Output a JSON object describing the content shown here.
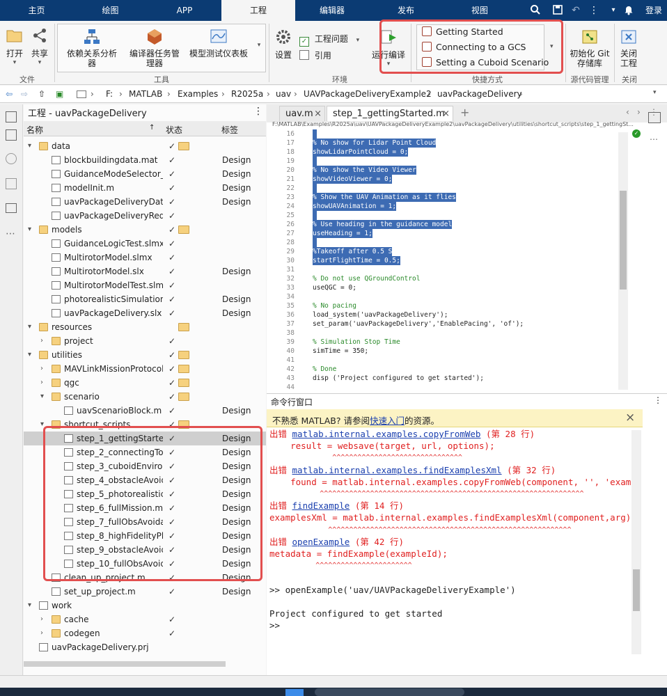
{
  "tabs": [
    "主页",
    "绘图",
    "APP",
    "工程",
    "编辑器",
    "发布",
    "视图"
  ],
  "login_label": "登录",
  "ribbon": {
    "file": {
      "open": "打开",
      "share": "共享",
      "section": "文件"
    },
    "tools": {
      "dep": "依赖关系分析器",
      "compiler": "编译器任务管理器",
      "dashboard": "模型测试仪表板",
      "section": "工具"
    },
    "env": {
      "settings": "设置",
      "issues": "工程问题",
      "references": "引用",
      "run_compile": "运行编译",
      "section": "环境"
    },
    "shortcuts": {
      "items": [
        "Getting Started",
        "Connecting to a GCS",
        "Setting a Cuboid Scenario"
      ],
      "section": "快捷方式"
    },
    "git": {
      "init": "初始化 Git 存储库",
      "section": "源代码管理"
    },
    "close": {
      "label": "关闭工程",
      "section": "关闭"
    }
  },
  "address": [
    "F:",
    "MATLAB",
    "Examples",
    "R2025a",
    "uav",
    "UAVPackageDeliveryExample2",
    "uavPackageDelivery"
  ],
  "project": {
    "title": "工程 - uavPackageDelivery",
    "cols": {
      "name": "名称",
      "status": "状态",
      "label": "标签"
    },
    "rows": [
      {
        "name": "data",
        "depth": 1,
        "folder": true,
        "open": true,
        "label": ""
      },
      {
        "name": "blockbuildingdata.mat",
        "depth": 2,
        "folder": false,
        "label": "Design"
      },
      {
        "name": "GuidanceModeSelector_...",
        "depth": 2,
        "folder": false,
        "label": "Design"
      },
      {
        "name": "modelInit.m",
        "depth": 2,
        "folder": false,
        "label": "Design"
      },
      {
        "name": "uavPackageDeliveryData...",
        "depth": 2,
        "folder": false,
        "label": "Design"
      },
      {
        "name": "uavPackageDeliveryReqs...",
        "depth": 2,
        "folder": false,
        "label": ""
      },
      {
        "name": "models",
        "depth": 1,
        "folder": true,
        "open": true,
        "label": ""
      },
      {
        "name": "GuidanceLogicTest.slmx",
        "depth": 2,
        "folder": false,
        "label": ""
      },
      {
        "name": "MultirotorModel.slmx",
        "depth": 2,
        "folder": false,
        "label": ""
      },
      {
        "name": "MultirotorModel.slx",
        "depth": 2,
        "folder": false,
        "label": "Design"
      },
      {
        "name": "MultirotorModelTest.slmx",
        "depth": 2,
        "folder": false,
        "label": ""
      },
      {
        "name": "photorealisticSimulation...",
        "depth": 2,
        "folder": false,
        "label": "Design"
      },
      {
        "name": "uavPackageDelivery.slx",
        "depth": 2,
        "folder": false,
        "label": "Design"
      },
      {
        "name": "resources",
        "depth": 1,
        "folder": true,
        "open": true,
        "label": ""
      },
      {
        "name": "project",
        "depth": 2,
        "folder": true,
        "open": false,
        "label": ""
      },
      {
        "name": "utilities",
        "depth": 1,
        "folder": true,
        "open": true,
        "label": ""
      },
      {
        "name": "MAVLinkMissionProtocol...",
        "depth": 2,
        "folder": true,
        "open": false,
        "label": ""
      },
      {
        "name": "qgc",
        "depth": 2,
        "folder": true,
        "open": false,
        "label": ""
      },
      {
        "name": "scenario",
        "depth": 2,
        "folder": true,
        "open": true,
        "label": ""
      },
      {
        "name": "uavScenarioBlock.m",
        "depth": 3,
        "folder": false,
        "label": "Design"
      },
      {
        "name": "shortcut_scripts",
        "depth": 2,
        "folder": true,
        "open": true,
        "label": ""
      },
      {
        "name": "step_1_gettingStarte...",
        "depth": 3,
        "folder": false,
        "label": "Design",
        "sel": true
      },
      {
        "name": "step_2_connectingTo...",
        "depth": 3,
        "folder": false,
        "label": "Design"
      },
      {
        "name": "step_3_cuboidEnviro...",
        "depth": 3,
        "folder": false,
        "label": "Design"
      },
      {
        "name": "step_4_obstacleAvoid...",
        "depth": 3,
        "folder": false,
        "label": "Design"
      },
      {
        "name": "step_5_photorealistic...",
        "depth": 3,
        "folder": false,
        "label": "Design"
      },
      {
        "name": "step_6_fullMission.m",
        "depth": 3,
        "folder": false,
        "label": "Design"
      },
      {
        "name": "step_7_fullObsAvoida...",
        "depth": 3,
        "folder": false,
        "label": "Design"
      },
      {
        "name": "step_8_highFidelityPl...",
        "depth": 3,
        "folder": false,
        "label": "Design"
      },
      {
        "name": "step_9_obstacleAvoid...",
        "depth": 3,
        "folder": false,
        "label": "Design"
      },
      {
        "name": "step_10_fullObsAvoid...",
        "depth": 3,
        "folder": false,
        "label": "Design"
      },
      {
        "name": "clean_up_project.m",
        "depth": 2,
        "folder": false,
        "label": "Design"
      },
      {
        "name": "set_up_project.m",
        "depth": 2,
        "folder": false,
        "label": "Design"
      },
      {
        "name": "work",
        "depth": 1,
        "folder": false,
        "open": true,
        "label": ""
      },
      {
        "name": "cache",
        "depth": 2,
        "folder": true,
        "open": false,
        "label": ""
      },
      {
        "name": "codegen",
        "depth": 2,
        "folder": true,
        "open": false,
        "label": ""
      },
      {
        "name": "uavPackageDelivery.prj",
        "depth": 1,
        "folder": false,
        "label": ""
      }
    ]
  },
  "editor": {
    "tabs": [
      "uav.m",
      "step_1_gettingStarted.m"
    ],
    "path": "F:\\MATLAB\\Examples\\R2025a\\uav\\UAVPackageDeliveryExample2\\uavPackageDelivery\\utilities\\shortcut_scripts\\step_1_gettingSt...",
    "lines": [
      {
        "n": "16",
        "t": "",
        "h": true
      },
      {
        "n": "17",
        "t": "% No show for Lidar Point Cloud",
        "h": true,
        "c": true
      },
      {
        "n": "18",
        "t": "showLidarPointCloud = 0;",
        "h": true
      },
      {
        "n": "19",
        "t": "",
        "h": true
      },
      {
        "n": "20",
        "t": "% No show the Video Viewer",
        "h": true,
        "c": true
      },
      {
        "n": "21",
        "t": "showVideoViewer = 0;",
        "h": true
      },
      {
        "n": "22",
        "t": "",
        "h": true
      },
      {
        "n": "23",
        "t": "% Show the UAV Animation as it flies",
        "h": true,
        "c": true
      },
      {
        "n": "24",
        "t": "showUAVAnimation = 1;",
        "h": true
      },
      {
        "n": "25",
        "t": "",
        "h": true
      },
      {
        "n": "26",
        "t": "% Use heading in the guidance model",
        "h": true,
        "c": true
      },
      {
        "n": "27",
        "t": "useHeading = 1;",
        "h": true
      },
      {
        "n": "28",
        "t": "",
        "h": true
      },
      {
        "n": "29",
        "t": "%Takeoff after 0.5 S",
        "h": true,
        "c": true
      },
      {
        "n": "30",
        "t": "startFlightTime = 0.5;",
        "h": true
      },
      {
        "n": "31",
        "t": "",
        "h": false
      },
      {
        "n": "32",
        "t": "% Do not use QGroundControl",
        "h": false,
        "c": true
      },
      {
        "n": "33",
        "t": "useQGC = 0;",
        "h": false
      },
      {
        "n": "34",
        "t": "",
        "h": false
      },
      {
        "n": "35",
        "t": "% No pacing",
        "h": false,
        "c": true
      },
      {
        "n": "36",
        "t": "load_system('uavPackageDelivery');",
        "h": false
      },
      {
        "n": "37",
        "t": "set_param('uavPackageDelivery','EnablePacing', 'of');",
        "h": false
      },
      {
        "n": "38",
        "t": "",
        "h": false
      },
      {
        "n": "39",
        "t": "% Simulation Stop Time",
        "h": false,
        "c": true
      },
      {
        "n": "40",
        "t": "simTime = 350;",
        "h": false
      },
      {
        "n": "41",
        "t": "",
        "h": false
      },
      {
        "n": "42",
        "t": "% Done",
        "h": false,
        "c": true
      },
      {
        "n": "43",
        "t": "disp ('Project configured to get started');",
        "h": false
      },
      {
        "n": "44",
        "t": "",
        "h": false
      }
    ]
  },
  "command": {
    "title": "命令行窗口",
    "notice_prefix": "不熟悉 MATLAB? 请参阅",
    "notice_link": "快速入门",
    "notice_suffix": "的资源。",
    "lines": [
      {
        "type": "err",
        "pre": "出错 ",
        "link": "matlab.internal.examples.copyFromWeb",
        "post": " (第 28 行)"
      },
      {
        "type": "errcode",
        "text": "    result = websave(target, url, options);"
      },
      {
        "type": "caret",
        "text": "               ^^^^^^^^^^^^^^^^^^^^^^^^^^^^^^^"
      },
      {
        "type": "err",
        "pre": "出错 ",
        "link": "matlab.internal.examples.findExamplesXml",
        "post": " (第 32 行)"
      },
      {
        "type": "errcode",
        "text": "    found = matlab.internal.examples.copyFromWeb(component, '', 'exampl"
      },
      {
        "type": "caret",
        "text": "            ^^^^^^^^^^^^^^^^^^^^^^^^^^^^^^^^^^^^^^^^^^^^^^^^^^^^^^^^^^^^^^^"
      },
      {
        "type": "err",
        "pre": "出错 ",
        "link": "findExample",
        "post": " (第 14 行)"
      },
      {
        "type": "errcode",
        "text": "examplesXml = matlab.internal.examples.findExamplesXml(component,arg);"
      },
      {
        "type": "caret",
        "text": "              ^^^^^^^^^^^^^^^^^^^^^^^^^^^^^^^^^^^^^^^^^^^^^^^^^^^^^^^^^^"
      },
      {
        "type": "err",
        "pre": "出错 ",
        "link": "openExample",
        "post": " (第 42 行)"
      },
      {
        "type": "errcode",
        "text": "metadata = findExample(exampleId);"
      },
      {
        "type": "caret",
        "text": "           ^^^^^^^^^^^^^^^^^^^^^^^"
      },
      {
        "type": "blank",
        "text": ""
      },
      {
        "type": "normal",
        "text": ">> openExample('uav/UAVPackageDeliveryExample')"
      },
      {
        "type": "blank",
        "text": ""
      },
      {
        "type": "normal",
        "text": "Project configured to get started"
      },
      {
        "type": "normal",
        "text": ">>"
      }
    ]
  },
  "colors": {
    "accent": "#0b3b73",
    "highlight": "#3d6bb3",
    "error": "#e02020",
    "redbox": "#e24f4f"
  }
}
